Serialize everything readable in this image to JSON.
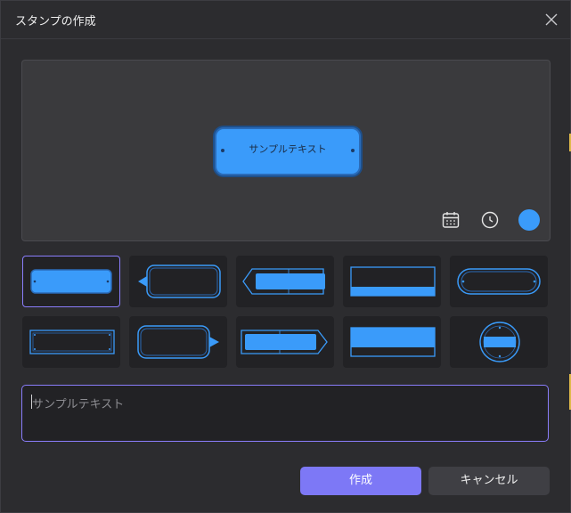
{
  "dialog": {
    "title": "スタンプの作成"
  },
  "preview": {
    "stamp_text": "サンプルテキスト",
    "stamp_color": "#3a9bfa",
    "tools": [
      "calendar-icon",
      "clock-icon",
      "color-swatch"
    ]
  },
  "templates": {
    "selected_index": 0,
    "count": 10
  },
  "text_input": {
    "placeholder": "サンプルテキスト"
  },
  "buttons": {
    "create_label": "作成",
    "cancel_label": "キャンセル"
  },
  "colors": {
    "accent": "#7d78f6",
    "stamp_blue": "#3a9bfa",
    "selection_border": "#8a7dfb"
  }
}
